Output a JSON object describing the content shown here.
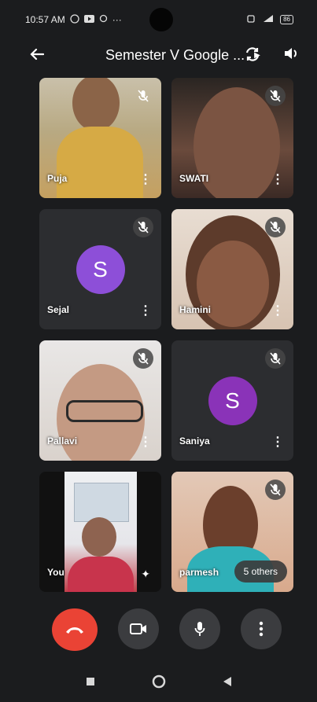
{
  "status_bar": {
    "time": "10:57 AM",
    "dots": "···",
    "battery": "86"
  },
  "app_bar": {
    "title": "Semester V Google ..."
  },
  "participants": [
    {
      "name": "Puja",
      "muted": true
    },
    {
      "name": "SWATI",
      "muted": true
    },
    {
      "name": "Sejal",
      "initial": "S",
      "muted": true,
      "avatar_color": "#8d4fd8"
    },
    {
      "name": "Hamini",
      "muted": true
    },
    {
      "name": "Pallavi",
      "muted": true
    },
    {
      "name": "Saniya",
      "initial": "S",
      "muted": true,
      "avatar_color": "#8a33b8"
    },
    {
      "name": "You",
      "muted": false
    },
    {
      "name": "parmesh",
      "muted": true
    }
  ],
  "others_label": "5 others",
  "colors": {
    "end_call": "#ea4335",
    "control_bg": "#3b3c3f"
  }
}
